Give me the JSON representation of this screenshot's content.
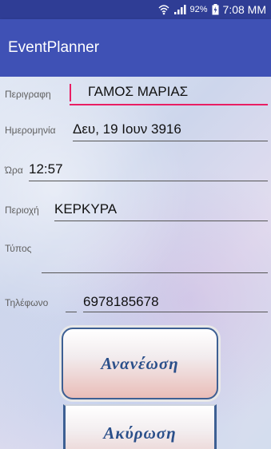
{
  "status_bar": {
    "battery": "92%",
    "time": "7:08 MM",
    "icons": [
      "wifi-icon",
      "signal-icon",
      "battery-icon"
    ]
  },
  "app_bar": {
    "title": "EventPlanner"
  },
  "form": {
    "description": {
      "label": "Περιγραφη",
      "value": "ΓΑΜΟΣ ΜΑΡΙΑΣ"
    },
    "date": {
      "label": "Ημερομηνία",
      "value": "Δευ, 19 Ιουν 3916"
    },
    "time": {
      "label": "Ώρα",
      "value": "12:57"
    },
    "area": {
      "label": "Περιοχή",
      "value": "ΚΕΡΚΥΡΑ"
    },
    "type": {
      "label": "Τύπος",
      "value": ""
    },
    "phone": {
      "label": "Τηλέφωνο",
      "value": "6978185678"
    }
  },
  "buttons": {
    "update": "Ανανέωση",
    "cancel": "Ακύρωση"
  },
  "colors": {
    "status_bar": "#2f3d95",
    "app_bar": "#3f51b5",
    "accent": "#e91e63",
    "button_text": "#2a4f8a"
  }
}
